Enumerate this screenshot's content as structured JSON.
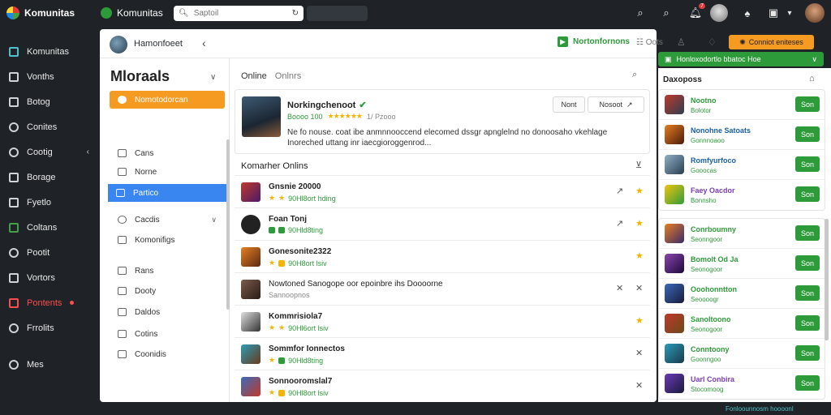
{
  "topbar": {
    "app_name_1": "Komunitas",
    "app_name_2": "Komunitas",
    "search_placeholder": "Saptoil",
    "notif_count": "7"
  },
  "sidebar": {
    "items": [
      {
        "label": "Komunitas"
      },
      {
        "label": "Vonths"
      },
      {
        "label": "Botog"
      },
      {
        "label": "Conites"
      },
      {
        "label": "Cootig"
      },
      {
        "label": "Borage"
      },
      {
        "label": "Fyetlo"
      },
      {
        "label": "Coltans"
      },
      {
        "label": "Pootit"
      },
      {
        "label": "Vortors"
      },
      {
        "label": "Pontents"
      },
      {
        "label": "Frrolits"
      },
      {
        "label": "Mes"
      }
    ]
  },
  "main": {
    "user_name": "Hamonfoeet",
    "header_buttons": {
      "green_label": "Nortonfornons",
      "grey_label_1": "Oots",
      "orange_label": "Conniot eniteses"
    },
    "left": {
      "title": "Mloraals",
      "items": [
        {
          "label": "Nomotodorcan"
        },
        {
          "label": "Cans"
        },
        {
          "label": "Norne"
        },
        {
          "label": "Partico"
        },
        {
          "label": "Cacdis"
        },
        {
          "label": "Komonifigs"
        },
        {
          "label": "Rans"
        },
        {
          "label": "Dooty"
        },
        {
          "label": "Daldos"
        },
        {
          "label": "Cotins"
        },
        {
          "label": "Coonidis"
        }
      ]
    },
    "tabs": [
      "Online",
      "Onlnrs"
    ],
    "card": {
      "name": "Norkingchenoot",
      "meta_green": "Boooo 100",
      "meta_grey": "1/ Pzooo",
      "desc": "Ne fo nouse. coat ibe anmnnooccend elecomed dssgr apnglelnd no donoosaho vkehlage Inoreched uttang inr iaecgioroggenrod...",
      "btn_1": "Nont",
      "btn_2": "Nosoot"
    },
    "list_title": "Komarher Onlins",
    "rows": [
      {
        "name": "Gnsnie 20000",
        "sub": "90Hl8ort hding"
      },
      {
        "name": "Foan Tonj",
        "sub": "90Hld8ting"
      },
      {
        "name": "Gonesonite2322",
        "sub": "90H8ort lsiv"
      },
      {
        "name": "Nowtoned Sanogope oor epoinbre ihs Doooorne",
        "sub": "Sannoopnos"
      },
      {
        "name": "Kommrisiola7",
        "sub": "90Hl6ort lsiv"
      },
      {
        "name": "Sommfor Ionnectos",
        "sub": "90Hld8ting"
      },
      {
        "name": "Sonnooromslal7",
        "sub": "90Hl8ort lsiv"
      }
    ]
  },
  "right": {
    "green_bar": "Honloxodortlo bbatoc Hoe",
    "title": "Daxoposs",
    "group1": [
      {
        "name": "Nootno",
        "sub": "Bolotor"
      },
      {
        "name": "Nonohne Satoats",
        "sub": "Gonnnoaoo"
      },
      {
        "name": "Romfyurfoco",
        "sub": "Gooocas"
      },
      {
        "name": "Faey Oacdor",
        "sub": "Bonnsho"
      }
    ],
    "group2": [
      {
        "name": "Conrboumny",
        "sub": "Seonngoor"
      },
      {
        "name": "Bomolt Od Ja",
        "sub": "Seonogoor"
      },
      {
        "name": "Ooohonntton",
        "sub": "Seoooogr"
      },
      {
        "name": "Sanoltoono",
        "sub": "Seonogoor"
      },
      {
        "name": "Conntoony",
        "sub": "Goonngoo"
      },
      {
        "name": "Uarl Conbira",
        "sub": "Stocomoog"
      }
    ],
    "button_label": "Son"
  },
  "footer": "Fonloounnosm hoooonl"
}
